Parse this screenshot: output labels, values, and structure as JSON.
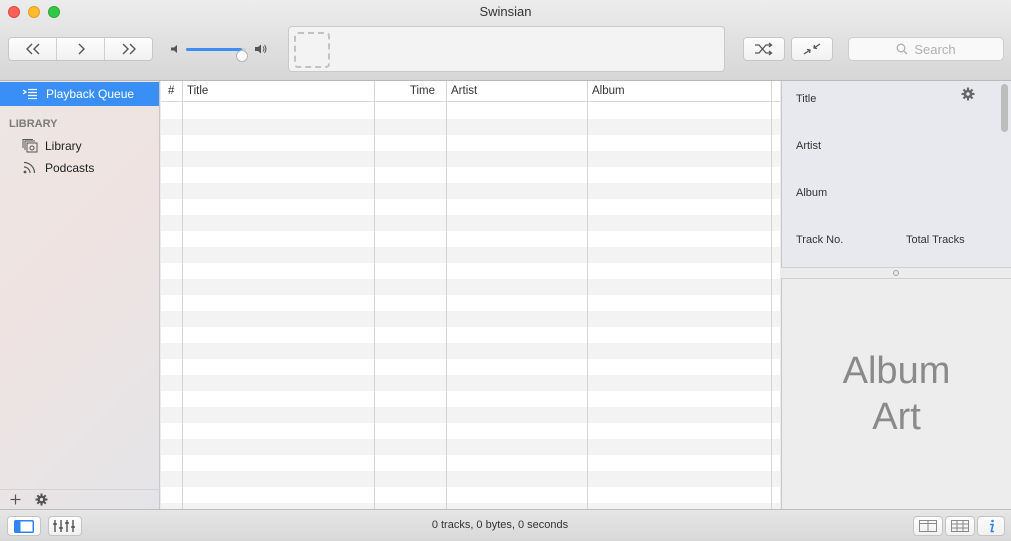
{
  "window": {
    "title": "Swinsian"
  },
  "player": {
    "volume_fraction": 0.94,
    "search_placeholder": "Search"
  },
  "sidebar": {
    "playback_queue": "Playback Queue",
    "section_title": "LIBRARY",
    "items": [
      {
        "label": "Library",
        "icon": "library-icon"
      },
      {
        "label": "Podcasts",
        "icon": "podcast-icon"
      }
    ]
  },
  "table": {
    "columns": [
      "#",
      "Title",
      "Time",
      "Artist",
      "Album"
    ]
  },
  "info_panel": {
    "title_label": "Title",
    "artist_label": "Artist",
    "album_label": "Album",
    "track_no_label": "Track No.",
    "total_tracks_label": "Total Tracks"
  },
  "album_art": {
    "placeholder_line1": "Album",
    "placeholder_line2": "Art"
  },
  "status": {
    "summary": "0 tracks,  0 bytes,  0 seconds"
  },
  "colors": {
    "accent": "#3a8ff7"
  }
}
